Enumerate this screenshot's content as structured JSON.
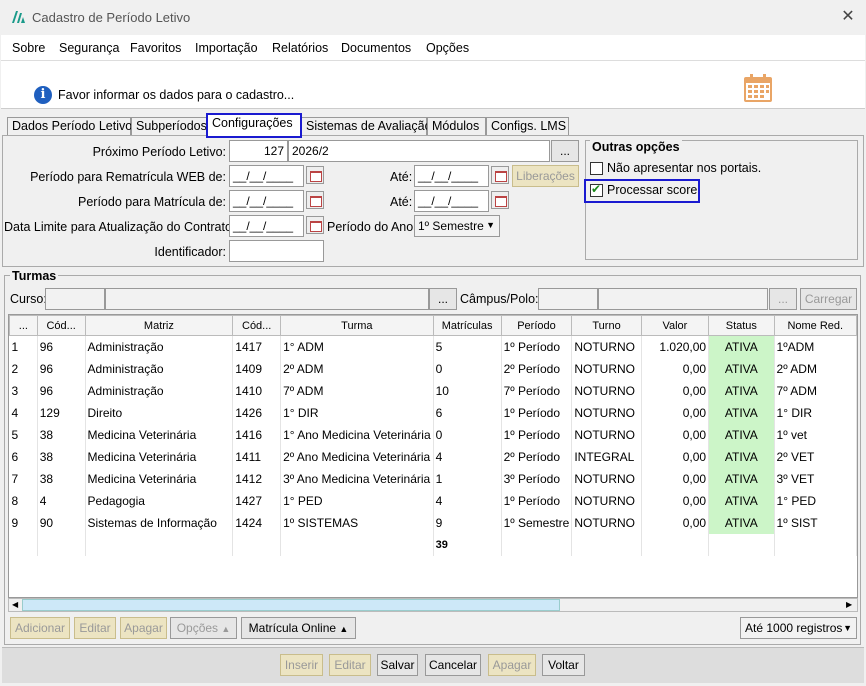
{
  "window": {
    "title": "Cadastro de Período Letivo",
    "close": "✕"
  },
  "menu": [
    "Sobre",
    "Segurança",
    "Favoritos",
    "Importação",
    "Relatórios",
    "Documentos",
    "Opções"
  ],
  "info": {
    "text": "Favor informar os dados para o cadastro..."
  },
  "tabs": [
    "Dados Período Letivo",
    "Subperíodos",
    "Configurações",
    "Sistemas de Avaliação",
    "Módulos",
    "Configs. LMS"
  ],
  "form": {
    "proximo_label": "Próximo Período Letivo:",
    "proximo_code": "127",
    "proximo_value": "2026/2",
    "proximo_btn": "...",
    "rematricula_label": "Período para Rematrícula WEB de:",
    "rematricula_de": "__/__/____",
    "ate_label": "Até:",
    "rematricula_ate": "__/__/____",
    "liberacoes": "Liberações",
    "matricula_label": "Período para Matrícula de:",
    "matricula_de": "__/__/____",
    "matricula_ate": "__/__/____",
    "data_limite_label": "Data Limite para Atualização do Contrato:",
    "data_limite": "__/__/____",
    "periodo_ano_label": "Período do Ano:",
    "periodo_ano": "1º Semestre",
    "identificador_label": "Identificador:",
    "identificador": ""
  },
  "outras": {
    "legend": "Outras opções",
    "nao_apresentar": "Não apresentar nos portais.",
    "processar": "Processar score."
  },
  "turmas": {
    "legend": "Turmas",
    "curso_label": "Curso:",
    "campus_label": "Câmpus/Polo:",
    "dots": "...",
    "carregar": "Carregar",
    "columns": [
      "...",
      "Cód...",
      "Matriz",
      "Cód...",
      "Turma",
      "Matrículas",
      "Período",
      "Turno",
      "Valor",
      "Status",
      "Nome Red."
    ],
    "rows": [
      [
        "1",
        "96",
        "Administração",
        "1417",
        "1° ADM",
        "5",
        "1º Período",
        "NOTURNO",
        "1.020,00",
        "ATIVA",
        "1ºADM"
      ],
      [
        "2",
        "96",
        "Administração",
        "1409",
        "2º ADM",
        "0",
        "2º Período",
        "NOTURNO",
        "0,00",
        "ATIVA",
        "2º ADM"
      ],
      [
        "3",
        "96",
        "Administração",
        "1410",
        "7º ADM",
        "10",
        "7º Período",
        "NOTURNO",
        "0,00",
        "ATIVA",
        "7º ADM"
      ],
      [
        "4",
        "129",
        "Direito",
        "1426",
        "1° DIR",
        "6",
        "1º Período",
        "NOTURNO",
        "0,00",
        "ATIVA",
        "1° DIR"
      ],
      [
        "5",
        "38",
        "Medicina Veterinária",
        "1416",
        "1°  Ano Medicina Veterinária",
        "0",
        "1º Período",
        "NOTURNO",
        "0,00",
        "ATIVA",
        "1º vet"
      ],
      [
        "6",
        "38",
        "Medicina Veterinária",
        "1411",
        "2º Ano Medicina Veterinária",
        "4",
        "2º Período",
        "INTEGRAL",
        "0,00",
        "ATIVA",
        "2º VET"
      ],
      [
        "7",
        "38",
        "Medicina Veterinária",
        "1412",
        "3º Ano Medicina Veterinária",
        "1",
        "3º Período",
        "NOTURNO",
        "0,00",
        "ATIVA",
        "3º VET"
      ],
      [
        "8",
        "4",
        "Pedagogia",
        "1427",
        "1° PED",
        "4",
        "1º Período",
        "NOTURNO",
        "0,00",
        "ATIVA",
        "1° PED"
      ],
      [
        "9",
        "90",
        "Sistemas de Informação",
        "1424",
        "1º SISTEMAS",
        "9",
        "1º Semestre",
        "NOTURNO",
        "0,00",
        "ATIVA",
        "1º SIST"
      ]
    ],
    "total_matriculas": "39"
  },
  "grid_buttons": {
    "adicionar": "Adicionar",
    "editar": "Editar",
    "apagar": "Apagar",
    "opcoes": "Opções",
    "matricula_online": "Matrícula Online",
    "ate_registros": "Até 1000 registros"
  },
  "footer": {
    "inserir": "Inserir",
    "editar": "Editar",
    "salvar": "Salvar",
    "cancelar": "Cancelar",
    "apagar": "Apagar",
    "voltar": "Voltar"
  },
  "colors": {
    "highlight": "#1a1ad0",
    "status_bg": "#ccf5c8",
    "disabled_btn": "#ece4c2"
  }
}
